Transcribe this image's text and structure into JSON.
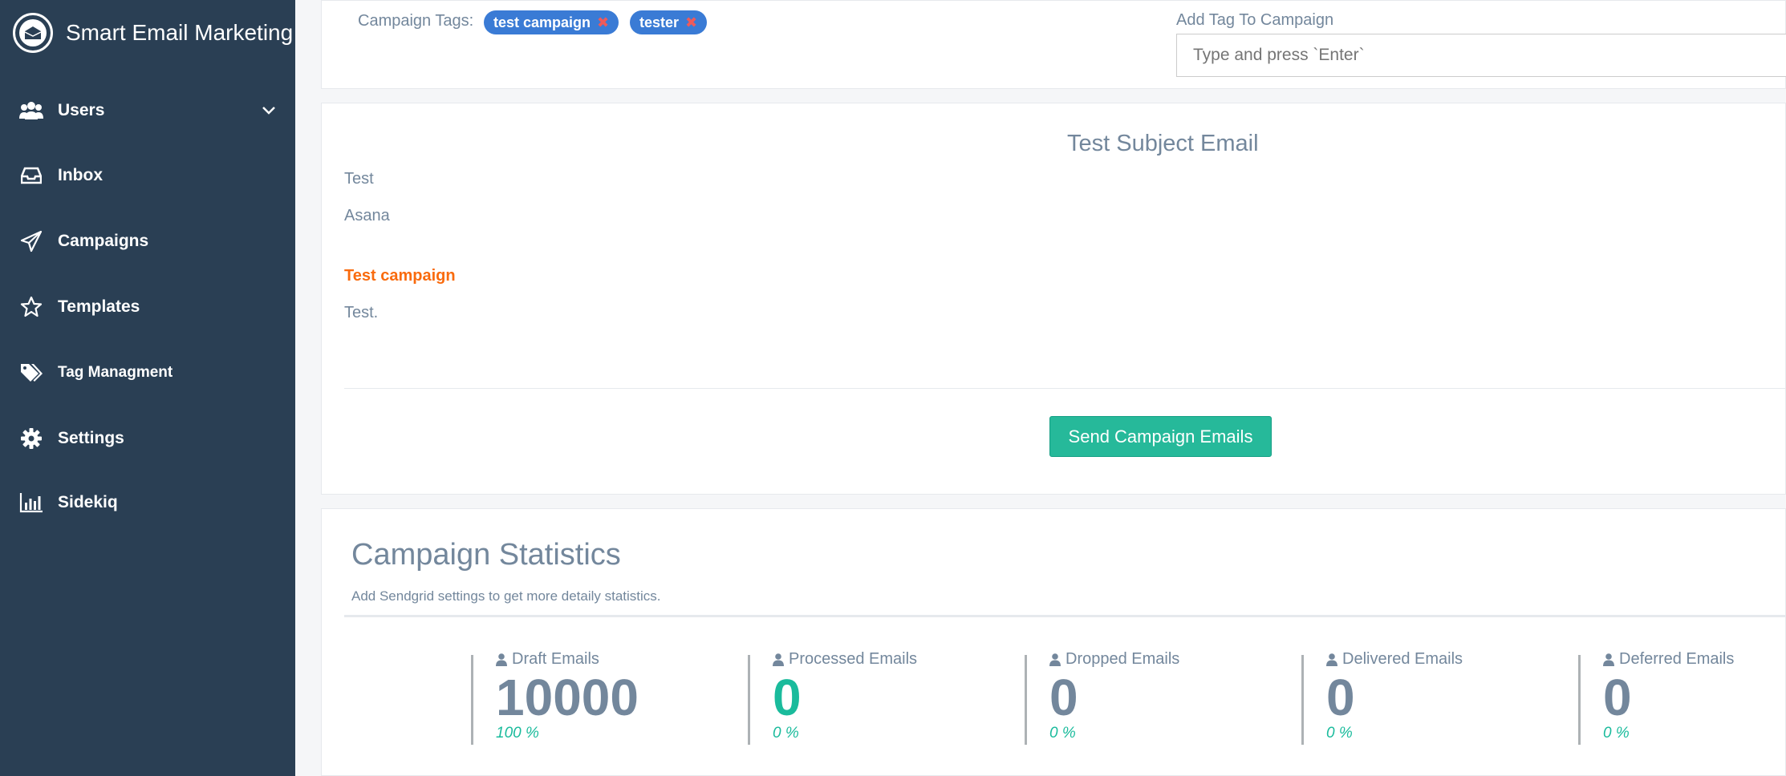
{
  "app": {
    "title": "Smart Email Marketing",
    "logo_icon": "envelope-open-icon"
  },
  "sidebar": {
    "items": [
      {
        "label": "Users",
        "icon": "users-icon",
        "has_submenu": true
      },
      {
        "label": "Inbox",
        "icon": "inbox-icon"
      },
      {
        "label": "Campaigns",
        "icon": "paper-plane-icon"
      },
      {
        "label": "Templates",
        "icon": "star-icon"
      },
      {
        "label": "Tag Managment",
        "icon": "tags-icon"
      },
      {
        "label": "Settings",
        "icon": "gear-icon"
      },
      {
        "label": "Sidekiq",
        "icon": "bar-chart-icon"
      }
    ]
  },
  "tags": {
    "label": "Campaign Tags:",
    "items": [
      {
        "name": "test campaign"
      },
      {
        "name": "tester"
      }
    ],
    "add_label": "Add Tag To Campaign",
    "add_placeholder": "Type and press `Enter`"
  },
  "email": {
    "subject": "Test Subject Email",
    "lines": [
      "Test",
      "Asana"
    ],
    "highlight": "Test campaign",
    "closing": "Test.",
    "send_button": "Send Campaign Emails"
  },
  "stats": {
    "title": "Campaign Statistics",
    "subtitle": "Add Sendgrid settings to get more detaily statistics.",
    "items": [
      {
        "label": "Draft Emails",
        "value": "10000",
        "percent": "100 %",
        "accent": false
      },
      {
        "label": "Processed Emails",
        "value": "0",
        "percent": "0 %",
        "accent": true
      },
      {
        "label": "Dropped Emails",
        "value": "0",
        "percent": "0 %",
        "accent": false
      },
      {
        "label": "Delivered Emails",
        "value": "0",
        "percent": "0 %",
        "accent": false
      },
      {
        "label": "Deferred Emails",
        "value": "0",
        "percent": "0 %",
        "accent": false
      }
    ]
  },
  "colors": {
    "sidebar_bg": "#2a3f54",
    "tag_bg": "#3a7bd5",
    "accent_green": "#1abb9c",
    "button_green": "#26b99a",
    "highlight_orange": "#f96b0e",
    "text_gray": "#73879c"
  }
}
